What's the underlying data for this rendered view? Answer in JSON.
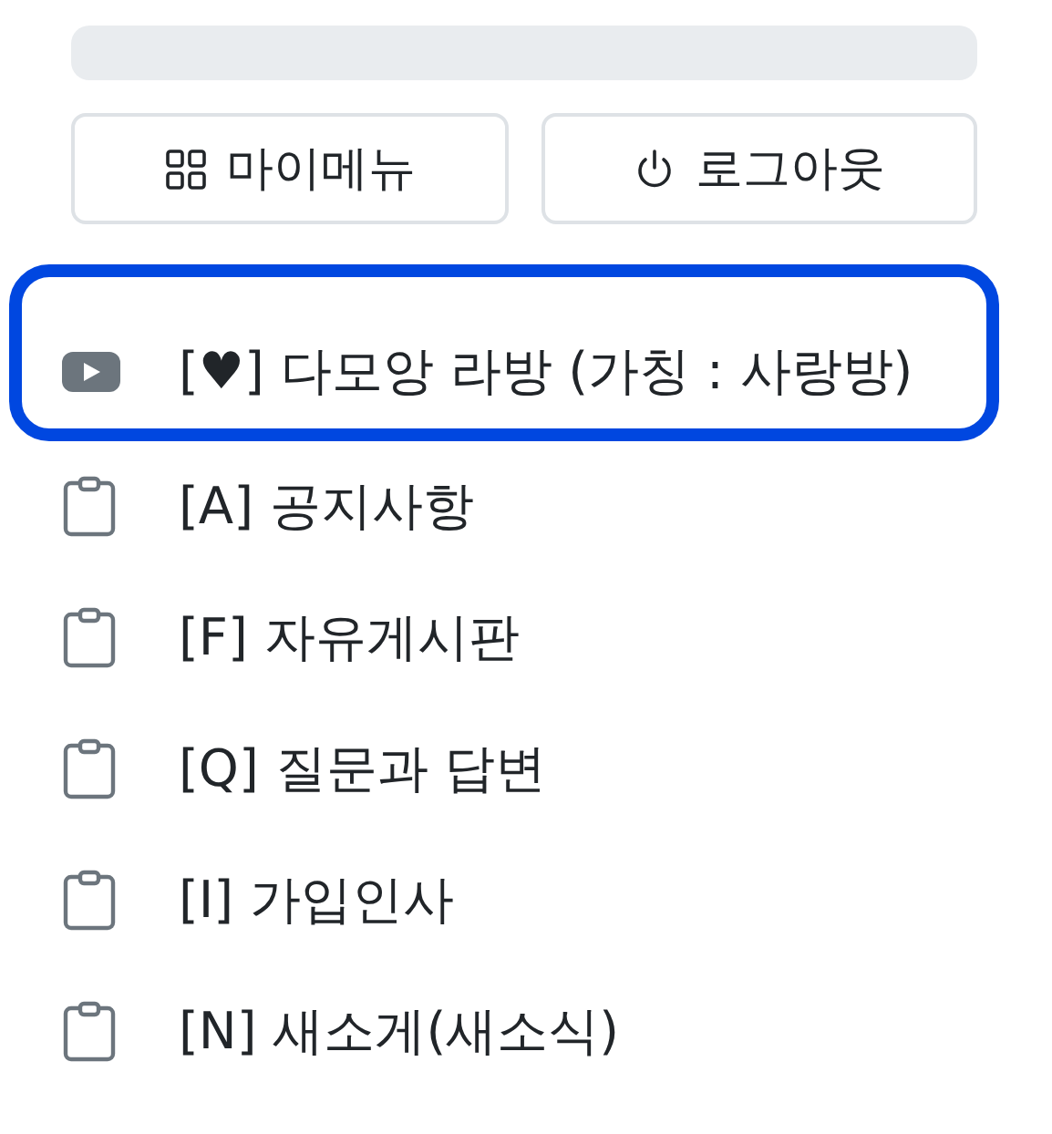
{
  "search_bar": {
    "kind": "empty"
  },
  "buttons": [
    {
      "label": "마이메뉴",
      "kind": "menu"
    },
    {
      "label": "로그아웃",
      "kind": "logout"
    }
  ],
  "menu": [
    {
      "label": "[♥] 다모앙 라방 (가칭 : 사랑방)",
      "kind": "video",
      "highlighted": true
    },
    {
      "label": "[A] 공지사항",
      "kind": "board",
      "highlighted": false
    },
    {
      "label": "[F] 자유게시판",
      "kind": "board",
      "highlighted": false
    },
    {
      "label": "[Q] 질문과 답변",
      "kind": "board",
      "highlighted": false
    },
    {
      "label": "[I] 가입인사",
      "kind": "board",
      "highlighted": false
    },
    {
      "label": "[N] 새소게(새소식)",
      "kind": "board",
      "highlighted": false
    }
  ]
}
